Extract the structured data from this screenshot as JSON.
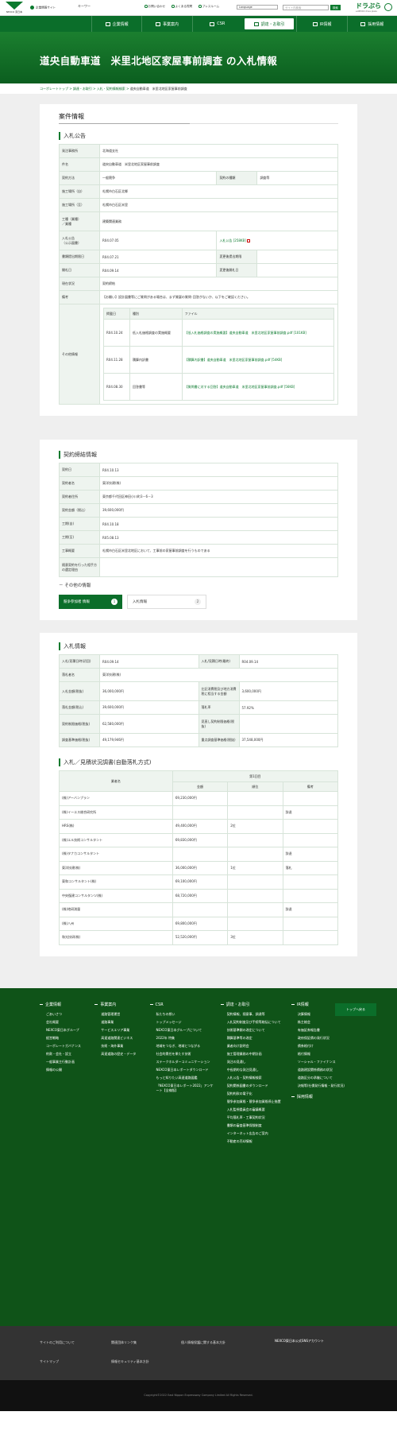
{
  "header": {
    "logo": "NEXCO 東日本",
    "corp_info": "企業情報サイト",
    "keyword": "キーワー",
    "util": [
      "お問い合わせ",
      "よくある質問",
      "プレスルーム"
    ],
    "language": "Language",
    "search_placeholder": "サイト内検索",
    "search_btn": "検索",
    "drapura": "ドラぷら",
    "drapura_sub": "e-NEXCO drive plaza"
  },
  "nav": [
    "企業情報",
    "事業案内",
    "CSR",
    "調達・お取引",
    "IR情報",
    "採用情報"
  ],
  "title": "道央自動車道　米里北地区家屋事前調査 の入札情報",
  "breadcrumb": [
    "コーポレートトップ",
    "調達・お取引",
    "入札・契約情報検索",
    "道央自動車道　米里北地区家屋事前調査"
  ],
  "case_heading": "案件情報",
  "bid_section": "入札公告",
  "bid": {
    "発注事務所": "北海道支社",
    "件名": "道央自動車道　米里北地区家屋事前調査",
    "契約方法": "一般競争",
    "契約の種類": "調査等",
    "施工場所（自）": "札幌市白石区北郷",
    "施工場所（至）": "札幌市白石区米里",
    "工種（業種）／業種": "建築関連業務",
    "入札公告（公示図書）": "R04.07.05",
    "notice_file": "入札公告 [258KB]",
    "書類提出期限日": "R04.07.21",
    "変更後提出期限": "",
    "開札日": "R04.09.14",
    "変更後開札日": "",
    "現在状況": "契約締結",
    "備考": "【お願い】設計図書等にご質問がある場合は、まず質疑の質問･回答がないか、以下をご確認ください。",
    "その他情報": "その他情報"
  },
  "inner_head": [
    "掲載日",
    "種別",
    "ファイル"
  ],
  "inner_rows": [
    [
      "R04.10.24",
      "低入札価格調査の実施概要",
      "【低入札価格調査の実施概要】道央自動車道　米里北地区家屋事前調査.pdf [101KB]"
    ],
    [
      "R04.11.28",
      "積算内訳書",
      "【積算内訳書】道央自動車道　米里北地区家屋事前調査.pdf [54KB]"
    ],
    [
      "R04.08.30",
      "回答書等",
      "【質問書に対する回答】道央自動車道　米里北地区家屋事前調査.pdf [56KB]"
    ]
  ],
  "contract_section": "契約締結情報",
  "contract": [
    [
      "契約日",
      "R04.10.13"
    ],
    [
      "契約者名",
      "東洋技建(株)"
    ],
    [
      "契約者住所",
      "東京都千代田区神田小川町3－6－3"
    ],
    [
      "契約金額（税込）",
      "39,600,000円"
    ],
    [
      "工期(自)",
      "R04.10.18"
    ],
    [
      "工期(至)",
      "R05.08.13"
    ],
    [
      "工事概要",
      "札幌市白石区米里北地区において、工事前の家屋事前調査を行うものである"
    ],
    [
      "随意契約を行った相手方の選定理由",
      ""
    ]
  ],
  "others_label": "その他の情報",
  "tabs": [
    {
      "label": "競争参加者 情報",
      "num": "1"
    },
    {
      "label": "入札情報",
      "num": "2"
    }
  ],
  "bidinfo_section": "入札情報",
  "bidinfo": [
    [
      "入札/見積日時(初回)",
      "R04.09.14",
      "入札/見積日時(最終)",
      "R04.09.14"
    ],
    [
      "落札者名",
      "東洋技建(株)",
      "",
      ""
    ],
    [
      "入札金額(税抜)",
      "36,000,000円",
      "左記消費税及び地方消費税に相当する金額",
      "3,600,000円"
    ],
    [
      "落札金額(税込)",
      "39,600,000円",
      "落札率",
      "57.92%"
    ],
    [
      "契約制限価格(税抜)",
      "62,580,000円",
      "見直し契約制限価格(税抜)",
      ""
    ],
    [
      "調査基準価格(税抜)",
      "49,179,946円",
      "重点調査基準価格(税抜)",
      "37,548,000円"
    ]
  ],
  "result_section": "入札／見積状況調書(自動落札方式)",
  "result_head": {
    "name": "業者名",
    "round": "第1回目",
    "cols": [
      "金額",
      "順位",
      "備考"
    ]
  },
  "result_rows": [
    [
      "(株)アーバンプラン",
      "69,230,000円",
      "",
      ""
    ],
    [
      "(株)イーエス総合研究所",
      "",
      "",
      "辞退"
    ],
    [
      "HRS(株)",
      "49,400,000円",
      "2位",
      ""
    ],
    [
      "(株)エル技術コンサルタント",
      "69,830,000円",
      "",
      ""
    ],
    [
      "(株)タナカコンサルタント",
      "",
      "",
      "辞退"
    ],
    [
      "東洋技建(株)",
      "36,000,000円",
      "1位",
      "落札"
    ],
    [
      "東和コンサルタント(株)",
      "69,100,000円",
      "",
      ""
    ],
    [
      "中央復建コンサルタンツ(株)",
      "68,720,000円",
      "",
      ""
    ],
    [
      "(株)地研測量",
      "",
      "",
      "辞退"
    ],
    [
      "(株)八州",
      "69,800,000円",
      "",
      ""
    ],
    [
      "和光技研(株)",
      "52,520,000円",
      "3位",
      ""
    ]
  ],
  "top_btn": "トップへ戻る",
  "footer": [
    {
      "h": "企業情報",
      "items": [
        "ごあいさつ",
        "会社概要",
        "NEXCO東日本グループ",
        "経営戦略",
        "コーポレートガバナンス",
        "約款・会社・設立",
        "一般事業主行動計画",
        "情報の公開"
      ]
    },
    {
      "h": "事業案内",
      "items": [
        "道路管理運営",
        "道路事業",
        "サービスエリア事業",
        "高速道路関連ビジネス",
        "技術・海外事業",
        "高速道路の歴史・データ"
      ]
    },
    {
      "h": "CSR",
      "items": [
        "私たちの想い",
        "トップメッセージ",
        "NEXCO東日本グループについて",
        "2022年 特集",
        "地域をつなぎ、地域とつながる",
        "社会的責任を果たす技術",
        "ステークホルダーコミュニケーション",
        "NEXCO東日本レポートダウンロード",
        "もっと知りたい高速道路図鑑",
        "「NEXCO東日本レポート2022」アンケート【全様版】"
      ]
    },
    {
      "h": "調達・お取引",
      "items": [
        "契約情報、随意事、調達等",
        "入札契約制度及び手続等総括について",
        "技術基準類の改定について",
        "積算基準等の改定",
        "業者向け説明会",
        "施工管理業務の中期計画",
        "発注の見通し",
        "中長期的な発注見通し",
        "入札公告・契約情報検索",
        "契約関係図書のダウンロード",
        "契約約款の電子化",
        "競争参加資格・競争参加資格停止措置",
        "入札監視委員会の審議概要",
        "平均落札率・工事契約状況",
        "書類の審査基準保険制度",
        "インターネット広告のご案内",
        "不動産の売却情報"
      ]
    },
    {
      "h": "IR情報",
      "items": [
        "決算情報",
        "株主総会",
        "有価証券報告書",
        "政府保証債の発行状況",
        "債券格付け",
        "格付情報",
        "ソーシャル・ファイナンス",
        "道路建設関係債務の状況",
        "道路区分の承継について",
        "決報等(社債発行情報・発行状況)"
      ]
    },
    {
      "h": "採用情報",
      "items": []
    }
  ],
  "sub_links": [
    "サイトのご利用について",
    "関連団体リンク集",
    "個人情報保護に関する基本方針",
    "サイトマップ",
    "情報セキュリティ基本方針",
    "NEXCO東日本公式SNSアカウント"
  ],
  "copyright": "Copyright©2022 East Nippon Expressway Company Limited All Rights Reserved."
}
